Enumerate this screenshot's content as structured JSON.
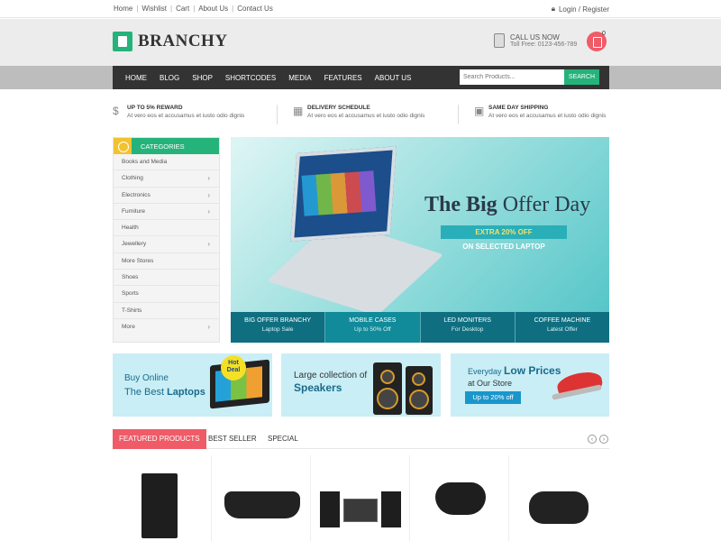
{
  "topbar": {
    "links": [
      "Home",
      "Wishlist",
      "Cart",
      "About Us",
      "Contact Us"
    ],
    "login": "Login / Register"
  },
  "header": {
    "logo": "BRANCHY",
    "call_title": "CALL US NOW",
    "call_number": "Toll Free: 0123-456-789",
    "cart_count": "0"
  },
  "nav": {
    "items": [
      "HOME",
      "BLOG",
      "SHOP",
      "SHORTCODES",
      "MEDIA",
      "FEATURES",
      "ABOUT US"
    ],
    "search_placeholder": "Search Products...",
    "search_button": "SEARCH"
  },
  "features": [
    {
      "icon": "dollar-icon",
      "title": "UP TO 5% REWARD",
      "text": "At vero eos et accusamus et iusto odio dignis"
    },
    {
      "icon": "calendar-icon",
      "title": "DELIVERY SCHEDULE",
      "text": "At vero eos et accusamus et iusto odio dignis"
    },
    {
      "icon": "truck-icon",
      "title": "SAME DAY SHIPPING",
      "text": "At vero eos et accusamus et iusto odio dignis"
    }
  ],
  "categories": {
    "title": "CATEGORIES",
    "items": [
      {
        "label": "Books and Media",
        "arrow": ""
      },
      {
        "label": "Clothing",
        "arrow": "›"
      },
      {
        "label": "Electronics",
        "arrow": "›"
      },
      {
        "label": "Furniture",
        "arrow": "›"
      },
      {
        "label": "Health",
        "arrow": ""
      },
      {
        "label": "Jewellery",
        "arrow": "›"
      },
      {
        "label": "More Stores",
        "arrow": ""
      },
      {
        "label": "Shoes",
        "arrow": ""
      },
      {
        "label": "Sports",
        "arrow": ""
      },
      {
        "label": "T-Shirts",
        "arrow": ""
      },
      {
        "label": "More",
        "arrow": "›"
      }
    ]
  },
  "banner": {
    "title_bold": "The Big",
    "title_rest": " Offer Day",
    "badge": "EXTRA 20% OFF",
    "subtitle": "ON SELECTED LAPTOP",
    "tabs": [
      {
        "title": "BIG OFFER BRANCHY",
        "sub": "Laptop Sale"
      },
      {
        "title": "MOBILE CASES",
        "sub": "Up to 50% Off"
      },
      {
        "title": "LED MONITERS",
        "sub": "For Desktop"
      },
      {
        "title": "COFFEE MACHINE",
        "sub": "Latest Offer"
      }
    ]
  },
  "promos": {
    "p1_line1": "Buy Online",
    "p1_line2a": "The Best ",
    "p1_line2b": "Laptops",
    "p1_badge_1": "Hot",
    "p1_badge_2": "Deal",
    "p2_line1": "Large collection of",
    "p2_line2": "Speakers",
    "p3_line1a": "Everyday ",
    "p3_line1b": "Low Prices",
    "p3_line2": "at Our Store",
    "p3_button": "Up to 20% off"
  },
  "product_tabs": {
    "items": [
      "FEATURED PRODUCTS",
      "BEST SELLER",
      "SPECIAL"
    ],
    "prev": "‹",
    "next": "›"
  },
  "colors": {
    "accent_green": "#25b37b",
    "accent_red": "#ef5b66",
    "nav_dark": "#333333",
    "teal": "#0f6f80"
  }
}
